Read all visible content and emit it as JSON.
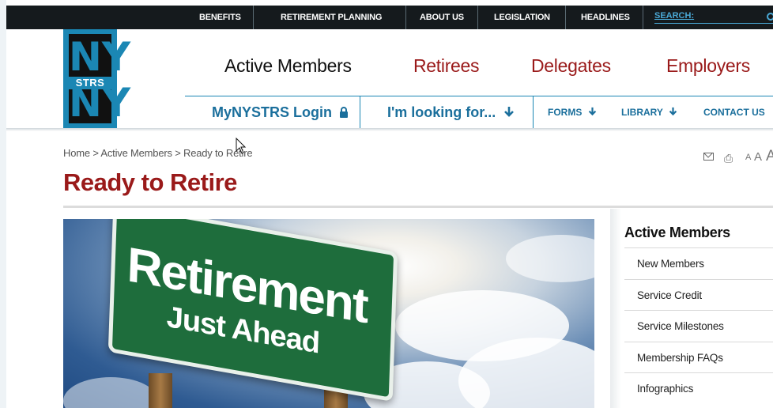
{
  "topbar": {
    "links": [
      "BENEFITS",
      "RETIREMENT PLANNING",
      "ABOUT US",
      "LEGISLATION",
      "HEADLINES"
    ],
    "search_label": "SEARCH:"
  },
  "logo": {
    "top": "NY",
    "middle": "STRS",
    "bottom": "NY"
  },
  "main_nav": [
    "Active Members",
    "Retirees",
    "Delegates",
    "Employers"
  ],
  "sub_nav": {
    "login": "MyNYSTRS Login",
    "looking": "I'm looking for...",
    "forms": "FORMS",
    "library": "LIBRARY",
    "contact": "CONTACT US"
  },
  "breadcrumb": [
    "Home",
    "Active Members",
    "Ready to Retire"
  ],
  "breadcrumb_sep": ">",
  "page_title": "Ready to Retire",
  "font_sizes": [
    "A",
    "A",
    "A"
  ],
  "hero": {
    "line1": "Retirement",
    "line2": "Just Ahead"
  },
  "sidebar": {
    "title": "Active Members",
    "items": [
      "New Members",
      "Service Credit",
      "Service Milestones",
      "Membership FAQs",
      "Infographics"
    ]
  },
  "colors": {
    "accent_blue": "#1b87b4",
    "title_red": "#9a1a1a",
    "topbar": "#151a1d"
  }
}
